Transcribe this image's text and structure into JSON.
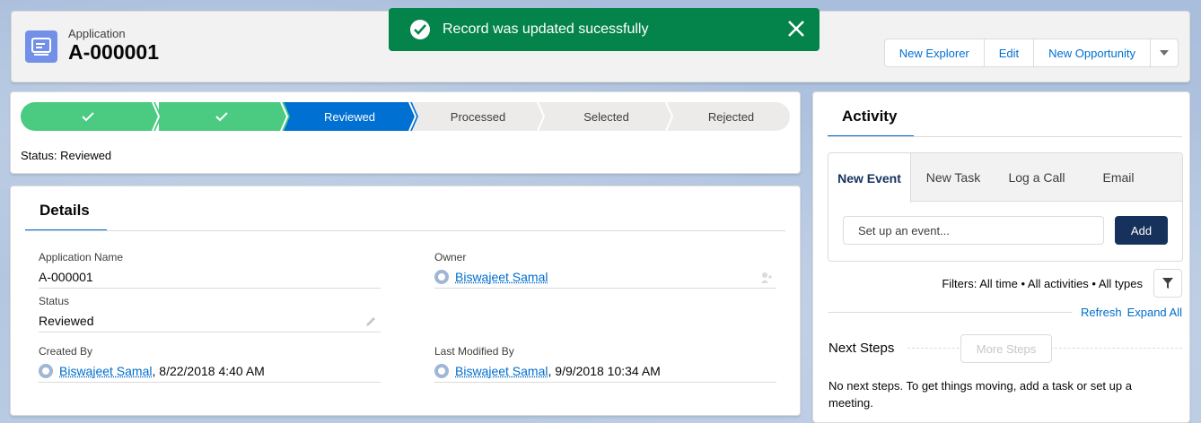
{
  "header": {
    "object_label": "Application",
    "record_title": "A-000001",
    "actions": [
      "New Explorer",
      "Edit",
      "New Opportunity"
    ]
  },
  "toast": {
    "message": "Record was updated sucessfully",
    "color": "#04844b"
  },
  "path": {
    "steps": [
      {
        "label": "",
        "state": "complete"
      },
      {
        "label": "",
        "state": "complete"
      },
      {
        "label": "Reviewed",
        "state": "current"
      },
      {
        "label": "Processed",
        "state": "incomplete"
      },
      {
        "label": "Selected",
        "state": "incomplete"
      },
      {
        "label": "Rejected",
        "state": "incomplete"
      }
    ],
    "status_text": "Status: Reviewed"
  },
  "details": {
    "tab_label": "Details",
    "application_name": {
      "label": "Application Name",
      "value": "A-000001"
    },
    "owner": {
      "label": "Owner",
      "value": "Biswajeet Samal"
    },
    "status": {
      "label": "Status",
      "value": "Reviewed"
    },
    "created_by": {
      "label": "Created By",
      "user": "Biswajeet Samal",
      "date": ", 8/22/2018 4:40 AM"
    },
    "last_modified_by": {
      "label": "Last Modified By",
      "user": "Biswajeet Samal",
      "date": ", 9/9/2018 10:34 AM"
    }
  },
  "activity": {
    "tab_label": "Activity",
    "composer_tabs": [
      "New Event",
      "New Task",
      "Log a Call",
      "Email"
    ],
    "event_placeholder": "Set up an event...",
    "add_label": "Add",
    "filters_text": "Filters: All time • All activities • All types",
    "refresh_label": "Refresh",
    "expand_all_label": "Expand All",
    "next_steps_label": "Next Steps",
    "more_steps_label": "More Steps",
    "no_steps_text": "No next steps. To get things moving, add a task or set up a meeting."
  },
  "colors": {
    "brand": "#0070d2",
    "path_complete": "#4bca81",
    "path_current": "#0070d2",
    "record_icon": "#7290e8",
    "add_button": "#16325c"
  }
}
